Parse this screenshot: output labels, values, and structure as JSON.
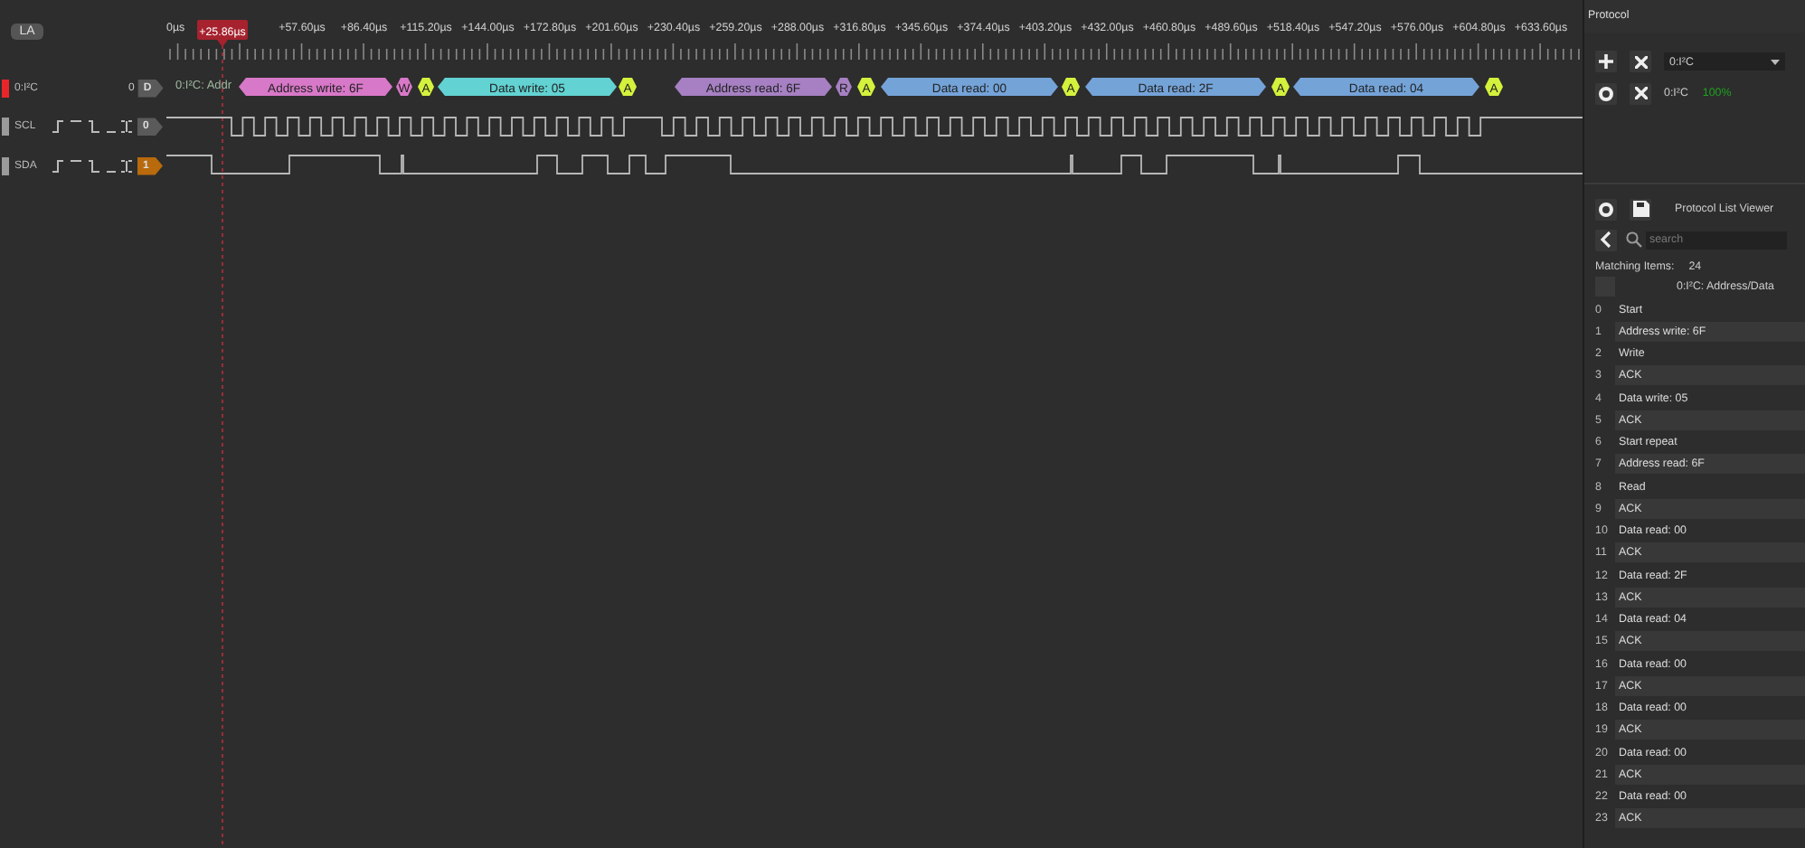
{
  "toolbar": {
    "button": "LA"
  },
  "ruler": {
    "labels": [
      "0µs",
      "+57.60µs",
      "+86.40µs",
      "+115.20µs",
      "+144.00µs",
      "+172.80µs",
      "+201.60µs",
      "+230.40µs",
      "+259.20µs",
      "+288.00µs",
      "+316.80µs",
      "+345.60µs",
      "+374.40µs",
      "+403.20µs",
      "+432.00µs",
      "+460.80µs",
      "+489.60µs",
      "+518.40µs",
      "+547.20µs",
      "+576.00µs",
      "+604.80µs",
      "+633.60µs"
    ],
    "marker": "+25.86µs"
  },
  "channels": [
    {
      "kind": "decoder",
      "name": "0:I²C",
      "value": "0",
      "button": "D",
      "color": "#e8262a"
    },
    {
      "kind": "logic",
      "name": "SCL",
      "value": "0",
      "high": false,
      "color": "#9a9a9a"
    },
    {
      "kind": "logic",
      "name": "SDA",
      "value": "1",
      "high": true,
      "color": "#9a9a9a"
    }
  ],
  "decoder_track": {
    "label": "0:I²C: Addr",
    "segments": [
      {
        "kind": "field",
        "text": "Address write: 6F",
        "color": "#d878c8"
      },
      {
        "kind": "bit",
        "text": "W",
        "color": "#d878c8"
      },
      {
        "kind": "bit",
        "text": "A",
        "color": "#d4f23c"
      },
      {
        "kind": "field",
        "text": "Data write: 05",
        "color": "#62d2d2"
      },
      {
        "kind": "bit",
        "text": "A",
        "color": "#d4f23c"
      },
      {
        "kind": "field",
        "text": "Address read: 6F",
        "color": "#a680c2"
      },
      {
        "kind": "bit",
        "text": "R",
        "color": "#a680c2"
      },
      {
        "kind": "bit",
        "text": "A",
        "color": "#d4f23c"
      },
      {
        "kind": "field",
        "text": "Data read: 00",
        "color": "#74a3d8"
      },
      {
        "kind": "bit",
        "text": "A",
        "color": "#d4f23c"
      },
      {
        "kind": "field",
        "text": "Data read: 2F",
        "color": "#74a3d8"
      },
      {
        "kind": "bit",
        "text": "A",
        "color": "#d4f23c"
      },
      {
        "kind": "field",
        "text": "Data read: 04",
        "color": "#74a3d8"
      },
      {
        "kind": "bit",
        "text": "A",
        "color": "#d4f23c"
      }
    ]
  },
  "protocol_panel": {
    "title": "Protocol",
    "selector": {
      "value": "0:I²C"
    },
    "decoder": {
      "name": "0:I²C",
      "progress": "100%"
    }
  },
  "list_viewer": {
    "title": "Protocol List Viewer",
    "search_placeholder": "search",
    "matching_label": "Matching Items:",
    "matching_count": "24",
    "column": "0:I²C: Address/Data",
    "rows": [
      {
        "index": "0",
        "text": "Start"
      },
      {
        "index": "1",
        "text": "Address write: 6F"
      },
      {
        "index": "2",
        "text": "Write"
      },
      {
        "index": "3",
        "text": "ACK"
      },
      {
        "index": "4",
        "text": "Data write: 05"
      },
      {
        "index": "5",
        "text": "ACK"
      },
      {
        "index": "6",
        "text": "Start repeat"
      },
      {
        "index": "7",
        "text": "Address read: 6F"
      },
      {
        "index": "8",
        "text": "Read"
      },
      {
        "index": "9",
        "text": "ACK"
      },
      {
        "index": "10",
        "text": "Data read: 00"
      },
      {
        "index": "11",
        "text": "ACK"
      },
      {
        "index": "12",
        "text": "Data read: 2F"
      },
      {
        "index": "13",
        "text": "ACK"
      },
      {
        "index": "14",
        "text": "Data read: 04"
      },
      {
        "index": "15",
        "text": "ACK"
      },
      {
        "index": "16",
        "text": "Data read: 00"
      },
      {
        "index": "17",
        "text": "ACK"
      },
      {
        "index": "18",
        "text": "Data read: 00"
      },
      {
        "index": "19",
        "text": "ACK"
      },
      {
        "index": "20",
        "text": "Data read: 00"
      },
      {
        "index": "21",
        "text": "ACK"
      },
      {
        "index": "22",
        "text": "Data read: 00"
      },
      {
        "index": "23",
        "text": "ACK"
      }
    ]
  }
}
